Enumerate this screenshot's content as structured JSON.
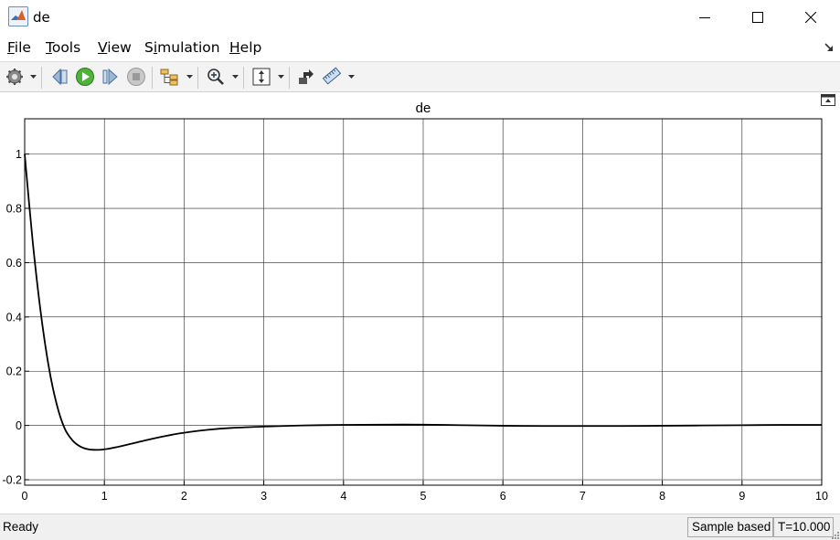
{
  "window": {
    "title": "de",
    "app_icon": "matlab-logo-icon",
    "controls": [
      "minimize-icon",
      "maximize-icon",
      "close-icon"
    ]
  },
  "menu": [
    {
      "label": "File",
      "mnemonic": "F",
      "rest": "ile"
    },
    {
      "label": "Tools",
      "mnemonic": "T",
      "rest": "ools"
    },
    {
      "label": "View",
      "mnemonic": "V",
      "rest": "iew"
    },
    {
      "label": "Simulation",
      "mnemonic": "i",
      "before": "S",
      "rest": "mulation"
    },
    {
      "label": "Help",
      "mnemonic": "H",
      "rest": "elp"
    }
  ],
  "toolbar": {
    "icons": [
      "settings-gear-icon",
      "step-back-icon",
      "run-icon",
      "step-forward-icon",
      "stop-icon",
      "signal-hierarchy-icon",
      "zoom-in-icon",
      "fit-to-view-icon",
      "highlight-simulink-block-icon",
      "measurements-ruler-icon"
    ]
  },
  "chart_data": {
    "type": "line",
    "title": "de",
    "xlabel": "",
    "ylabel": "",
    "xlim": [
      0,
      10
    ],
    "ylim": [
      -0.22,
      1.13
    ],
    "xticks": [
      0,
      1,
      2,
      3,
      4,
      5,
      6,
      7,
      8,
      9,
      10
    ],
    "yticks": [
      -0.2,
      0,
      0.2,
      0.4,
      0.6,
      0.8,
      1
    ],
    "ytick_labels": [
      "-0.2",
      "0",
      "0.2",
      "0.4",
      "0.6",
      "0.8",
      "1"
    ],
    "grid": true,
    "series": [
      {
        "color": "#000000",
        "x": [
          0,
          0.1,
          0.2,
          0.3,
          0.4,
          0.5,
          0.6,
          0.7,
          0.8,
          0.9,
          1.0,
          1.2,
          1.4,
          1.6,
          1.8,
          2.0,
          2.3,
          2.6,
          3.0,
          3.5,
          4.0,
          4.5,
          5.0,
          5.5,
          6.0,
          6.5,
          7.0,
          7.5,
          8.0,
          8.5,
          9.0,
          9.5,
          10.0
        ],
        "y": [
          1.0,
          0.68,
          0.42,
          0.22,
          0.08,
          -0.01,
          -0.055,
          -0.078,
          -0.088,
          -0.09,
          -0.088,
          -0.077,
          -0.063,
          -0.049,
          -0.037,
          -0.027,
          -0.016,
          -0.009,
          -0.004,
          0.0,
          0.002,
          0.003,
          0.003,
          0.001,
          -0.001,
          -0.002,
          -0.002,
          -0.002,
          -0.001,
          0.0,
          0.001,
          0.002,
          0.002
        ]
      }
    ]
  },
  "status": {
    "ready": "Ready",
    "sample": "Sample based",
    "time": "T=10.000"
  }
}
